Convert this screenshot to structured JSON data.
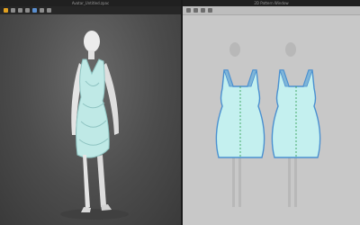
{
  "app": {
    "left_title": "Avatar_Untitled.zpac",
    "right_title": "2D Pattern Window"
  },
  "toolbar_3d": {
    "icons": [
      "select-icon",
      "move-icon",
      "rotate-icon",
      "zoom-icon",
      "display-icon",
      "settings-icon",
      "camera-icon"
    ]
  },
  "toolbar_2d": {
    "icons": [
      "select-icon",
      "pattern-icon",
      "accent-icon",
      "sewing-icon"
    ]
  },
  "colors": {
    "garment": "#bfe9e6",
    "garment_shadow": "#8fc4c2",
    "pattern_fill": "#c4f0ef",
    "pattern_outline": "#4a90d0",
    "strap_fill": "#7fb5d8",
    "seam_line": "#2a9a4a",
    "avatar": "#e8e8e8"
  }
}
